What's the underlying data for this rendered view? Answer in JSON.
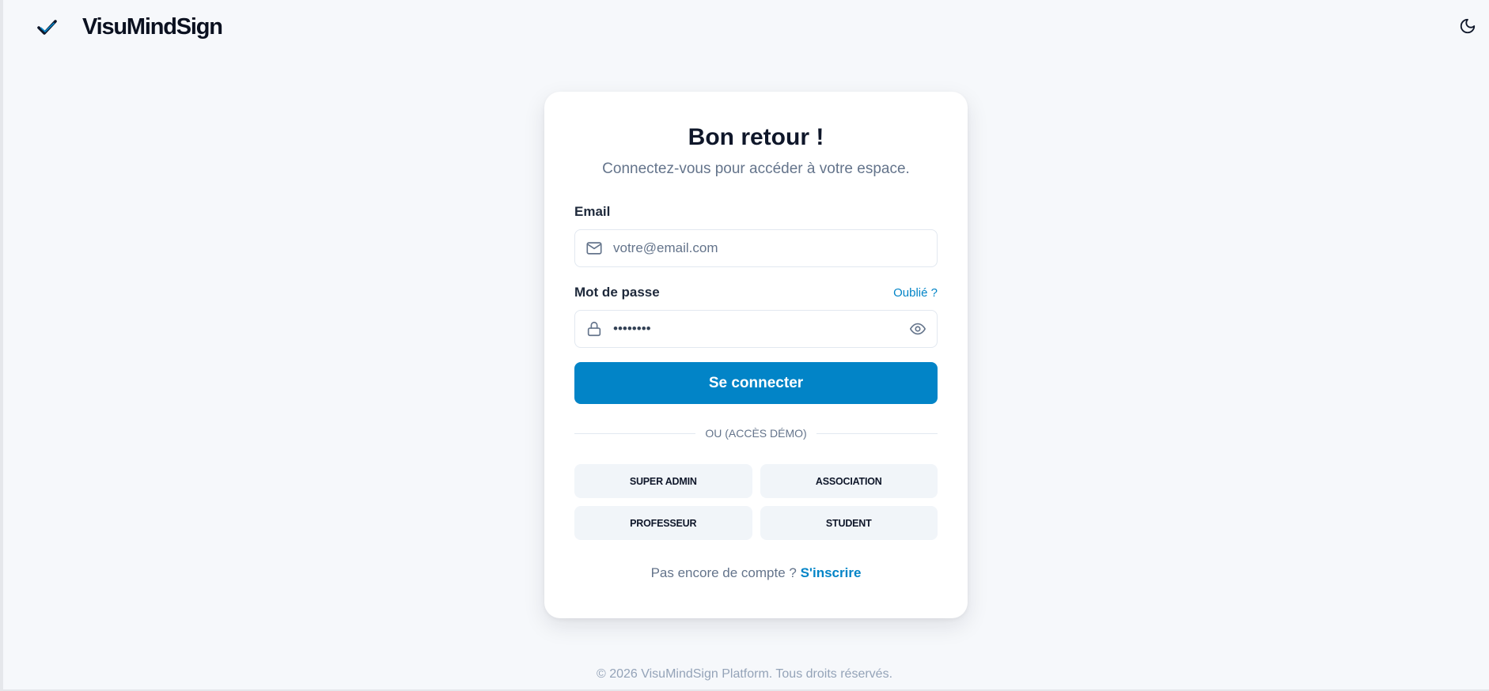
{
  "brand": {
    "name": "VisuMindSign",
    "logo_icon": "check-logo-icon",
    "accent": "#0284c7",
    "dark": "#0f172a"
  },
  "header": {
    "theme_toggle_icon": "moon-icon"
  },
  "login": {
    "title": "Bon retour !",
    "subtitle": "Connectez-vous pour accéder à votre espace.",
    "email": {
      "label": "Email",
      "placeholder": "votre@email.com",
      "value": "",
      "icon": "mail-icon"
    },
    "password": {
      "label": "Mot de passe",
      "forgot_label": "Oublié ?",
      "value": "••••••••",
      "icon": "lock-icon",
      "toggle_icon": "eye-icon"
    },
    "submit_label": "Se connecter",
    "divider_label": "OU (ACCÈS DÉMO)",
    "demo_buttons": [
      "SUPER ADMIN",
      "ASSOCIATION",
      "PROFESSEUR",
      "STUDENT"
    ],
    "signup": {
      "prompt": "Pas encore de compte ?",
      "link_label": "S'inscrire"
    }
  },
  "footer": {
    "text": "© 2026 VisuMindSign Platform. Tous droits réservés."
  }
}
